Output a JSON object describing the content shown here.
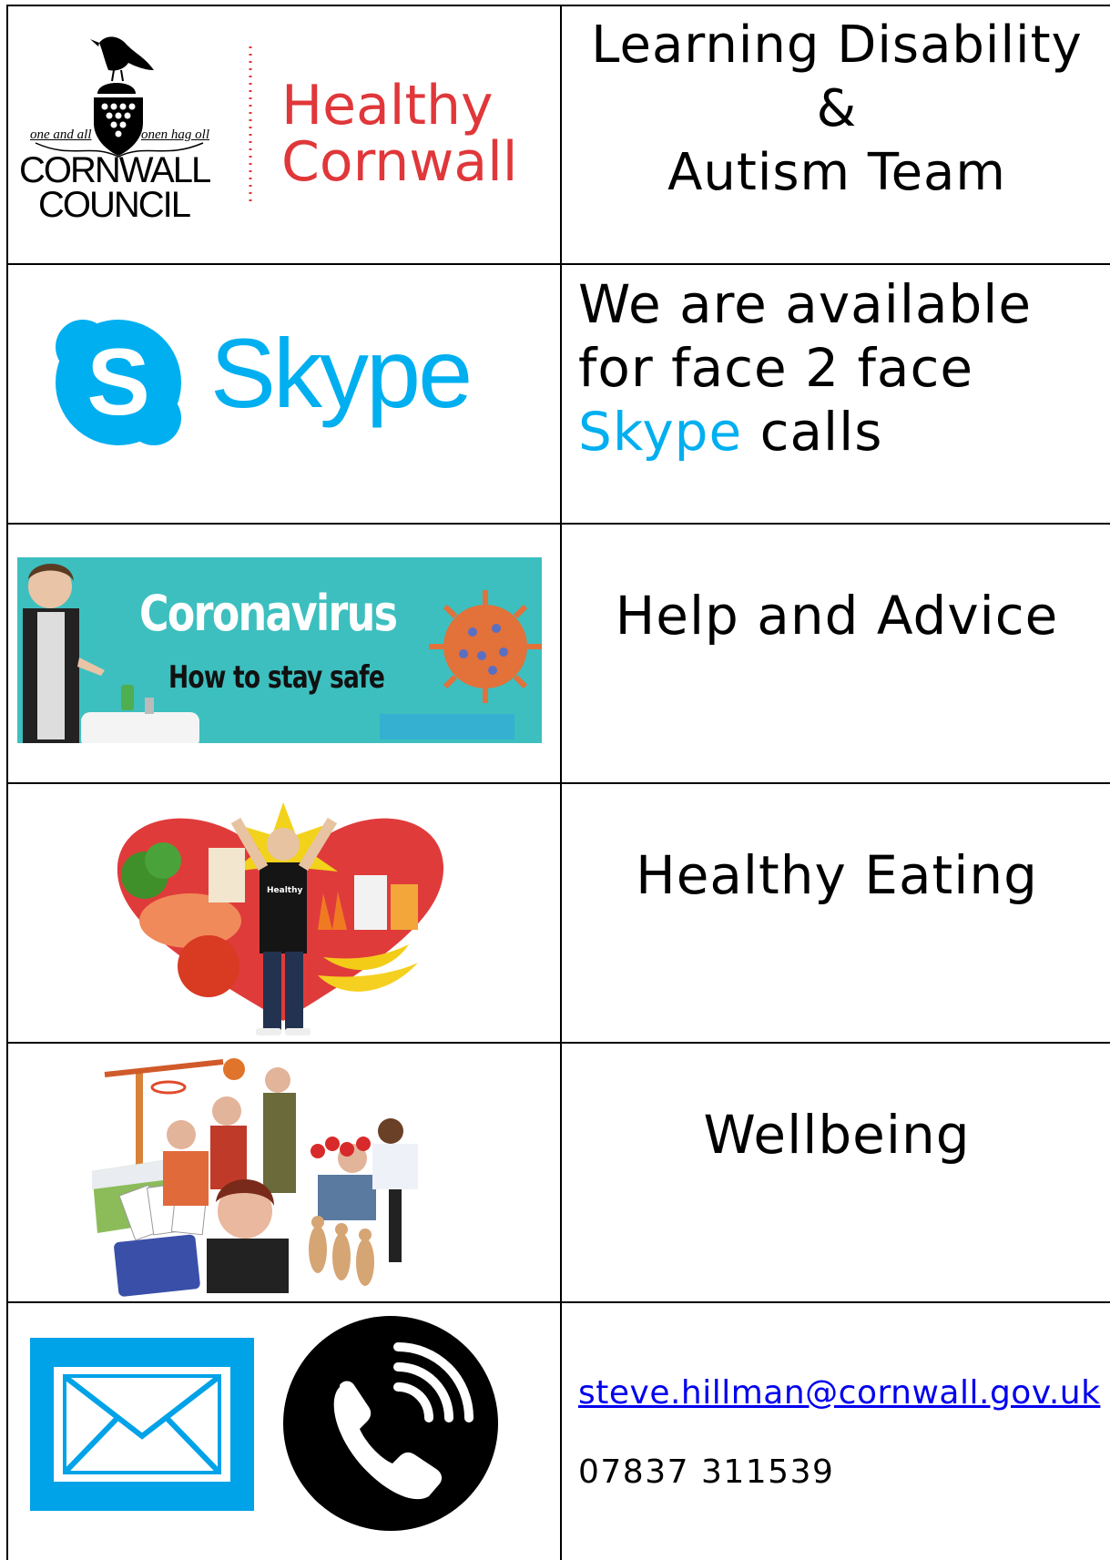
{
  "logo": {
    "motto_left": "one and all",
    "motto_right": "onen hag oll",
    "council_line1": "CORNWALL",
    "council_line2": "COUNCIL",
    "healthy_line1": "Healthy",
    "healthy_line2": "Cornwall",
    "healthy_color": "#e0373a"
  },
  "header": {
    "line1": "Learning Disability",
    "line2": "&",
    "line3": "Autism Team"
  },
  "skype": {
    "logo_text": "Skype",
    "logo_letter": "S",
    "brand_color": "#00aff0",
    "line1": "We are available",
    "line2": "for face 2 face",
    "line3_brand": "Skype",
    "line3_rest": " calls"
  },
  "coronavirus": {
    "banner_title": "Coronavirus",
    "banner_subtitle": "How to stay safe",
    "banner_color": "#3dbfbf",
    "label": "Help and Advice"
  },
  "eating": {
    "label": "Healthy Eating",
    "shirt_text": "Healthy"
  },
  "wellbeing": {
    "label": "Wellbeing"
  },
  "contact": {
    "email": "steve.hillman@cornwall.gov.uk",
    "phone": "07837 311539",
    "email_icon_color": "#00a2e8"
  }
}
